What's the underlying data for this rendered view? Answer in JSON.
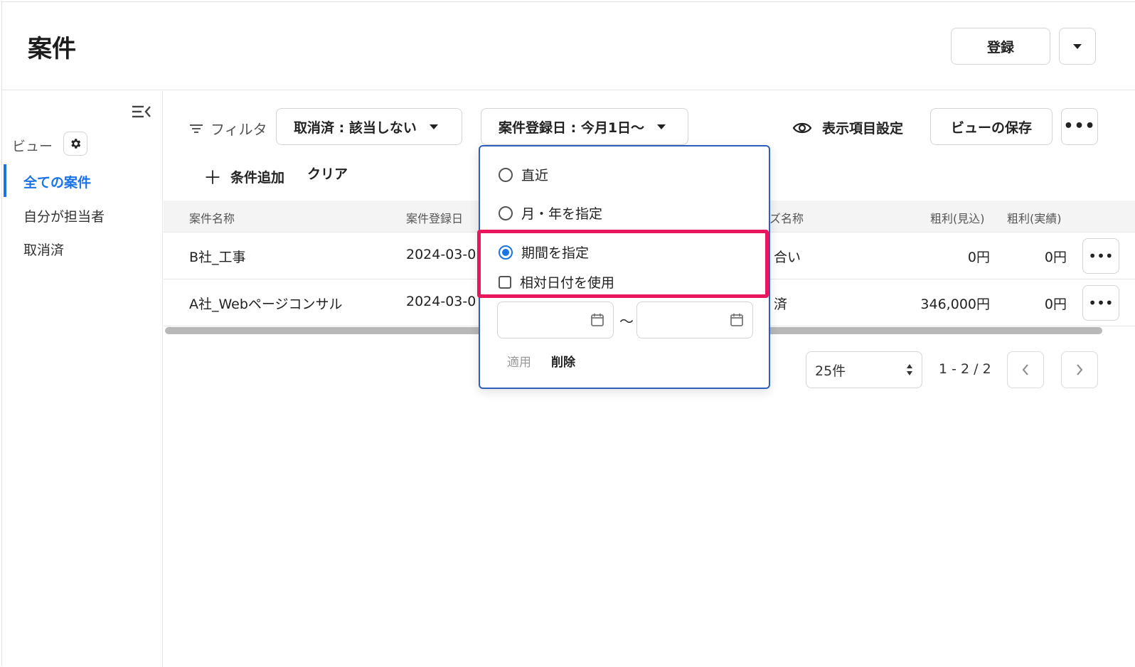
{
  "header": {
    "title": "案件",
    "register_label": "登録"
  },
  "sidebar": {
    "view_label": "ビュー",
    "items": [
      {
        "label": "全ての案件",
        "active": true
      },
      {
        "label": "自分が担当者",
        "active": false
      },
      {
        "label": "取消済",
        "active": false
      }
    ]
  },
  "toolbar": {
    "filter_label": "フィルタ",
    "cancel_filter": "取消済 : 該当しない",
    "date_filter": "案件登録日 : 今月1日〜",
    "display_settings": "表示項目設定",
    "save_view": "ビューの保存",
    "add_condition": "条件追加",
    "clear": "クリア"
  },
  "table": {
    "columns": [
      "案件名称",
      "案件登録日",
      "ズ名称",
      "粗利(見込)",
      "粗利(実績)"
    ],
    "rows": [
      {
        "name": "B社_工事",
        "date": "2024-03-0",
        "phase": "合い",
        "profit_est": "0円",
        "profit_act": "0円"
      },
      {
        "name": "A社_Webページコンサル",
        "date": "2024-03-0",
        "phase": "済",
        "profit_est": "346,000円",
        "profit_act": "0円"
      }
    ]
  },
  "pagination": {
    "per_page": "25件",
    "range": "1 - 2 / 2"
  },
  "date_popover": {
    "options": [
      {
        "label": "直近",
        "selected": false
      },
      {
        "label": "月・年を指定",
        "selected": false
      },
      {
        "label": "期間を指定",
        "selected": true
      }
    ],
    "relative_checkbox": "相対日付を使用",
    "range_separator": "〜",
    "apply": "適用",
    "delete": "削除"
  },
  "colors": {
    "accent": "#1a73e8",
    "highlight": "#e8175d",
    "popover_border": "#2d5fbf"
  }
}
